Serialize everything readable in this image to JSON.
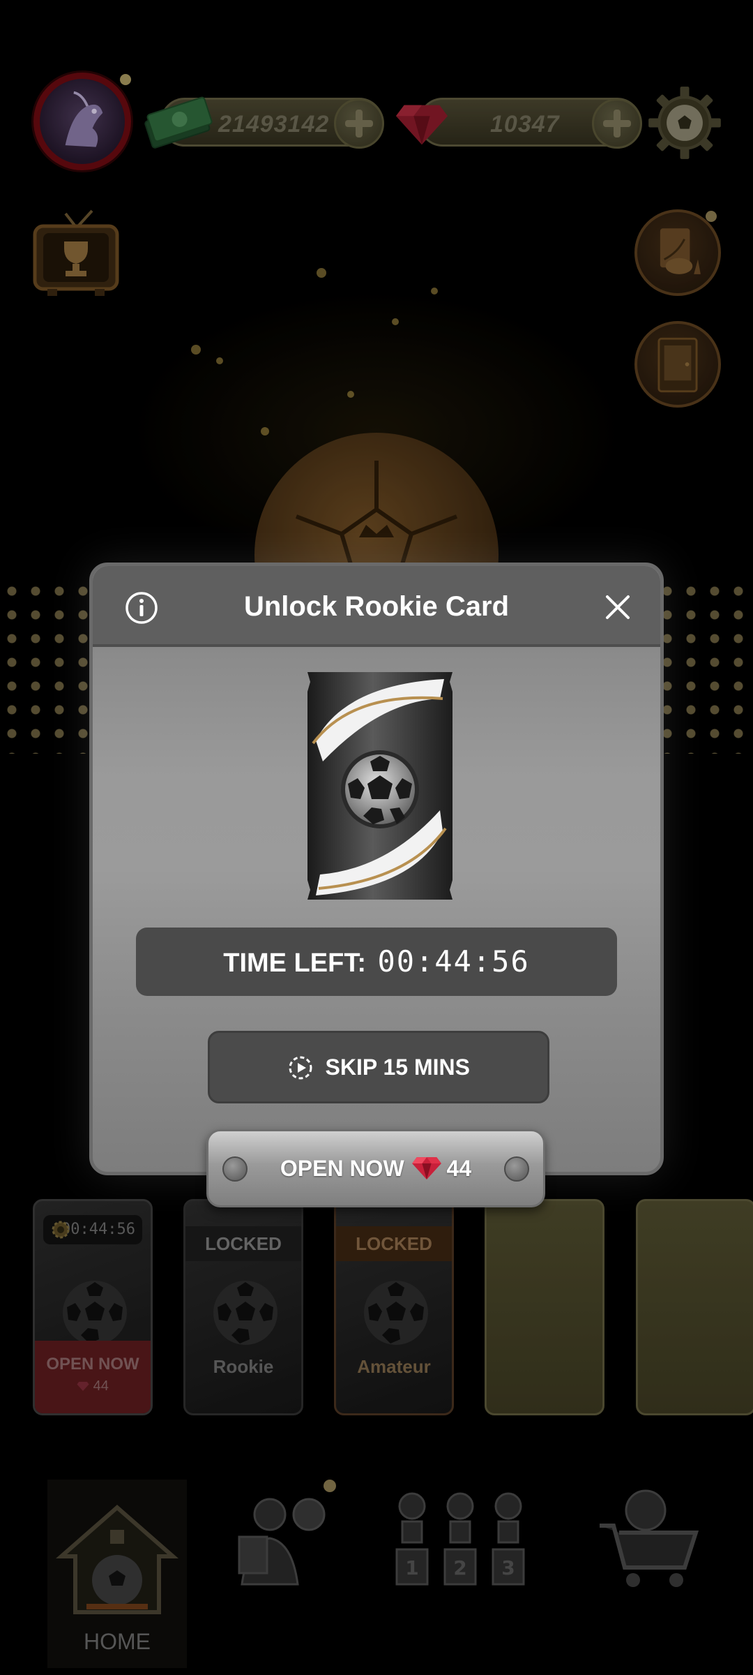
{
  "header": {
    "cash_amount": "21493142",
    "gems_amount": "10347"
  },
  "slots": [
    {
      "timer": "00:44:56",
      "action_label": "OPEN NOW",
      "cost": "44"
    },
    {
      "status": "LOCKED",
      "name": "Rookie"
    },
    {
      "status": "LOCKED",
      "name": "Amateur"
    },
    {
      "empty": true
    },
    {
      "empty": true
    }
  ],
  "nav": {
    "home_label": "HOME"
  },
  "modal": {
    "title": "Unlock Rookie Card",
    "time_left_label": "TIME LEFT:",
    "time_left_value": "00:44:56",
    "skip_label": "SKIP 15 MINS",
    "open_label": "OPEN NOW",
    "open_cost": "44"
  },
  "colors": {
    "background": "#000000",
    "modal_body": "#9a9a9a",
    "modal_header": "#5f5f5f",
    "button_dark": "#4b4b4b",
    "gem": "#d0203a",
    "gold": "#a89860"
  },
  "icons": {
    "info": "info-icon",
    "close": "close-icon",
    "skip": "play-timer-icon",
    "gem": "gem-icon",
    "settings": "gear-icon",
    "cash": "cash-icon"
  }
}
